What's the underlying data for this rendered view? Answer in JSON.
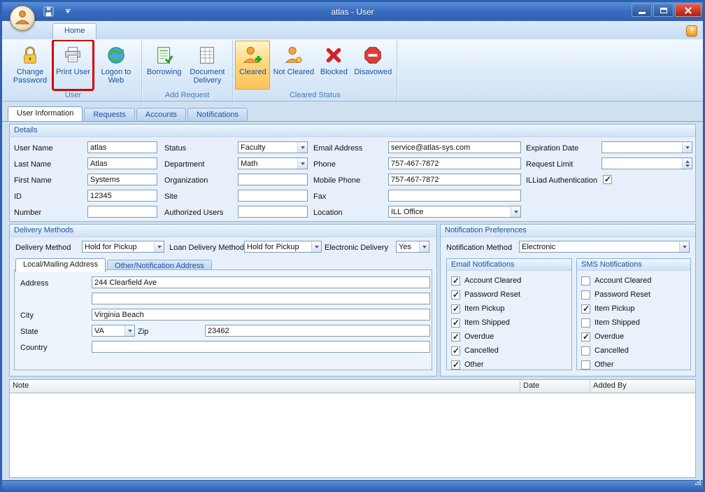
{
  "window": {
    "title": "atlas - User"
  },
  "ribbon": {
    "tab_home": "Home",
    "user_group": {
      "label": "User",
      "change_password": "Change Password",
      "print_user": "Print User",
      "logon_to_web": "Logon to Web"
    },
    "add_request_group": {
      "label": "Add Request",
      "borrowing": "Borrowing",
      "document_delivery": "Document Delivery"
    },
    "cleared_status_group": {
      "label": "Cleared Status",
      "cleared": "Cleared",
      "not_cleared": "Not Cleared",
      "blocked": "Blocked",
      "disavowed": "Disavowed"
    }
  },
  "page_tabs": {
    "user_information": "User Information",
    "requests": "Requests",
    "accounts": "Accounts",
    "notifications": "Notifications"
  },
  "details": {
    "title": "Details",
    "labels": {
      "user_name": "User Name",
      "status": "Status",
      "email": "Email Address",
      "expiration_date": "Expiration Date",
      "last_name": "Last Name",
      "department": "Department",
      "phone": "Phone",
      "request_limit": "Request Limit",
      "first_name": "First Name",
      "organization": "Organization",
      "mobile_phone": "Mobile Phone",
      "illiad_authentication": "ILLiad Authentication",
      "id": "ID",
      "site": "Site",
      "fax": "Fax",
      "number": "Number",
      "authorized_users": "Authorized Users",
      "location": "Location"
    },
    "values": {
      "user_name": "atlas",
      "status": "Faculty",
      "email": "service@atlas-sys.com",
      "expiration_date": "",
      "last_name": "Atlas",
      "department": "Math",
      "phone": "757-467-7872",
      "request_limit": "",
      "first_name": "Systems",
      "organization": "",
      "mobile_phone": "757-467-7872",
      "illiad_authentication": true,
      "id": "12345",
      "site": "",
      "fax": "",
      "number": "",
      "authorized_users": "",
      "location": "ILL Office"
    }
  },
  "delivery": {
    "title": "Delivery Methods",
    "delivery_method_label": "Delivery Method",
    "delivery_method_value": "Hold for Pickup",
    "loan_delivery_method_label": "Loan Delivery Method",
    "loan_delivery_method_value": "Hold for Pickup",
    "electronic_delivery_label": "Electronic Delivery",
    "electronic_delivery_value": "Yes",
    "address_tabs": {
      "local": "Local/Mailing Address",
      "other": "Other/Notification Address"
    },
    "labels": {
      "address": "Address",
      "city": "City",
      "state": "State",
      "zip": "Zip",
      "country": "Country"
    },
    "values": {
      "address1": "244 Clearfield Ave",
      "address2": "",
      "city": "Virginia Beach",
      "state": "VA",
      "zip": "23462",
      "country": ""
    }
  },
  "notification_prefs": {
    "title": "Notification Preferences",
    "method_label": "Notification Method",
    "method_value": "Electronic",
    "email": {
      "title": "Email Notifications",
      "items": [
        {
          "label": "Account Cleared",
          "checked": true
        },
        {
          "label": "Password Reset",
          "checked": true
        },
        {
          "label": "Item Pickup",
          "checked": true
        },
        {
          "label": "Item Shipped",
          "checked": true
        },
        {
          "label": "Overdue",
          "checked": true
        },
        {
          "label": "Cancelled",
          "checked": true
        },
        {
          "label": "Other",
          "checked": true
        }
      ]
    },
    "sms": {
      "title": "SMS Notifications",
      "items": [
        {
          "label": "Account Cleared",
          "checked": false
        },
        {
          "label": "Password Reset",
          "checked": false
        },
        {
          "label": "Item Pickup",
          "checked": true
        },
        {
          "label": "Item Shipped",
          "checked": false
        },
        {
          "label": "Overdue",
          "checked": true
        },
        {
          "label": "Cancelled",
          "checked": false
        },
        {
          "label": "Other",
          "checked": false
        }
      ]
    }
  },
  "notes": {
    "columns": {
      "note": "Note",
      "date": "Date",
      "added_by": "Added By"
    }
  }
}
